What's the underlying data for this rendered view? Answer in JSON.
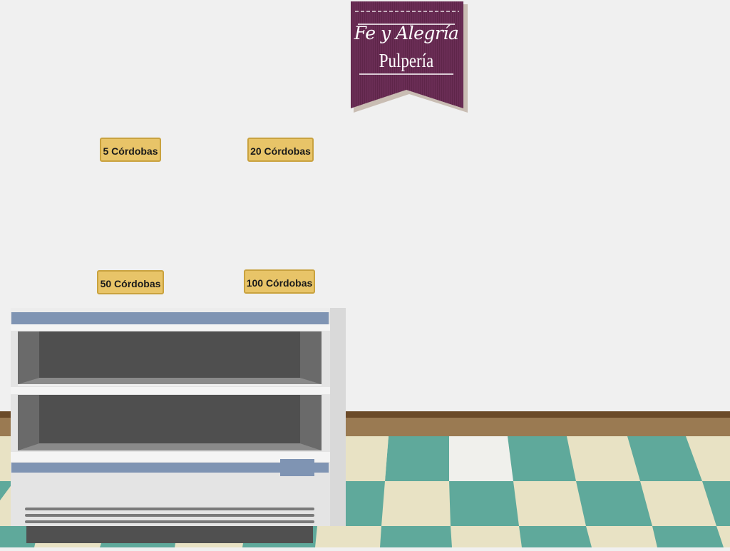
{
  "banner": {
    "script_text": "Fe y Alegría",
    "name_text": "Pulpería"
  },
  "money_buttons": [
    {
      "label": "5 Córdobas"
    },
    {
      "label": "20 Córdobas"
    },
    {
      "label": "50 Córdobas"
    },
    {
      "label": "100 Córdobas"
    }
  ],
  "colors": {
    "wall": "#f0f0f0",
    "banner": "#6a2d55",
    "button_fill": "#e8c468",
    "floor_teal": "#5fa99b",
    "floor_cream": "#e8e2c4",
    "baseboard": "#9a7a52",
    "counter_accent": "#7f94b3"
  }
}
